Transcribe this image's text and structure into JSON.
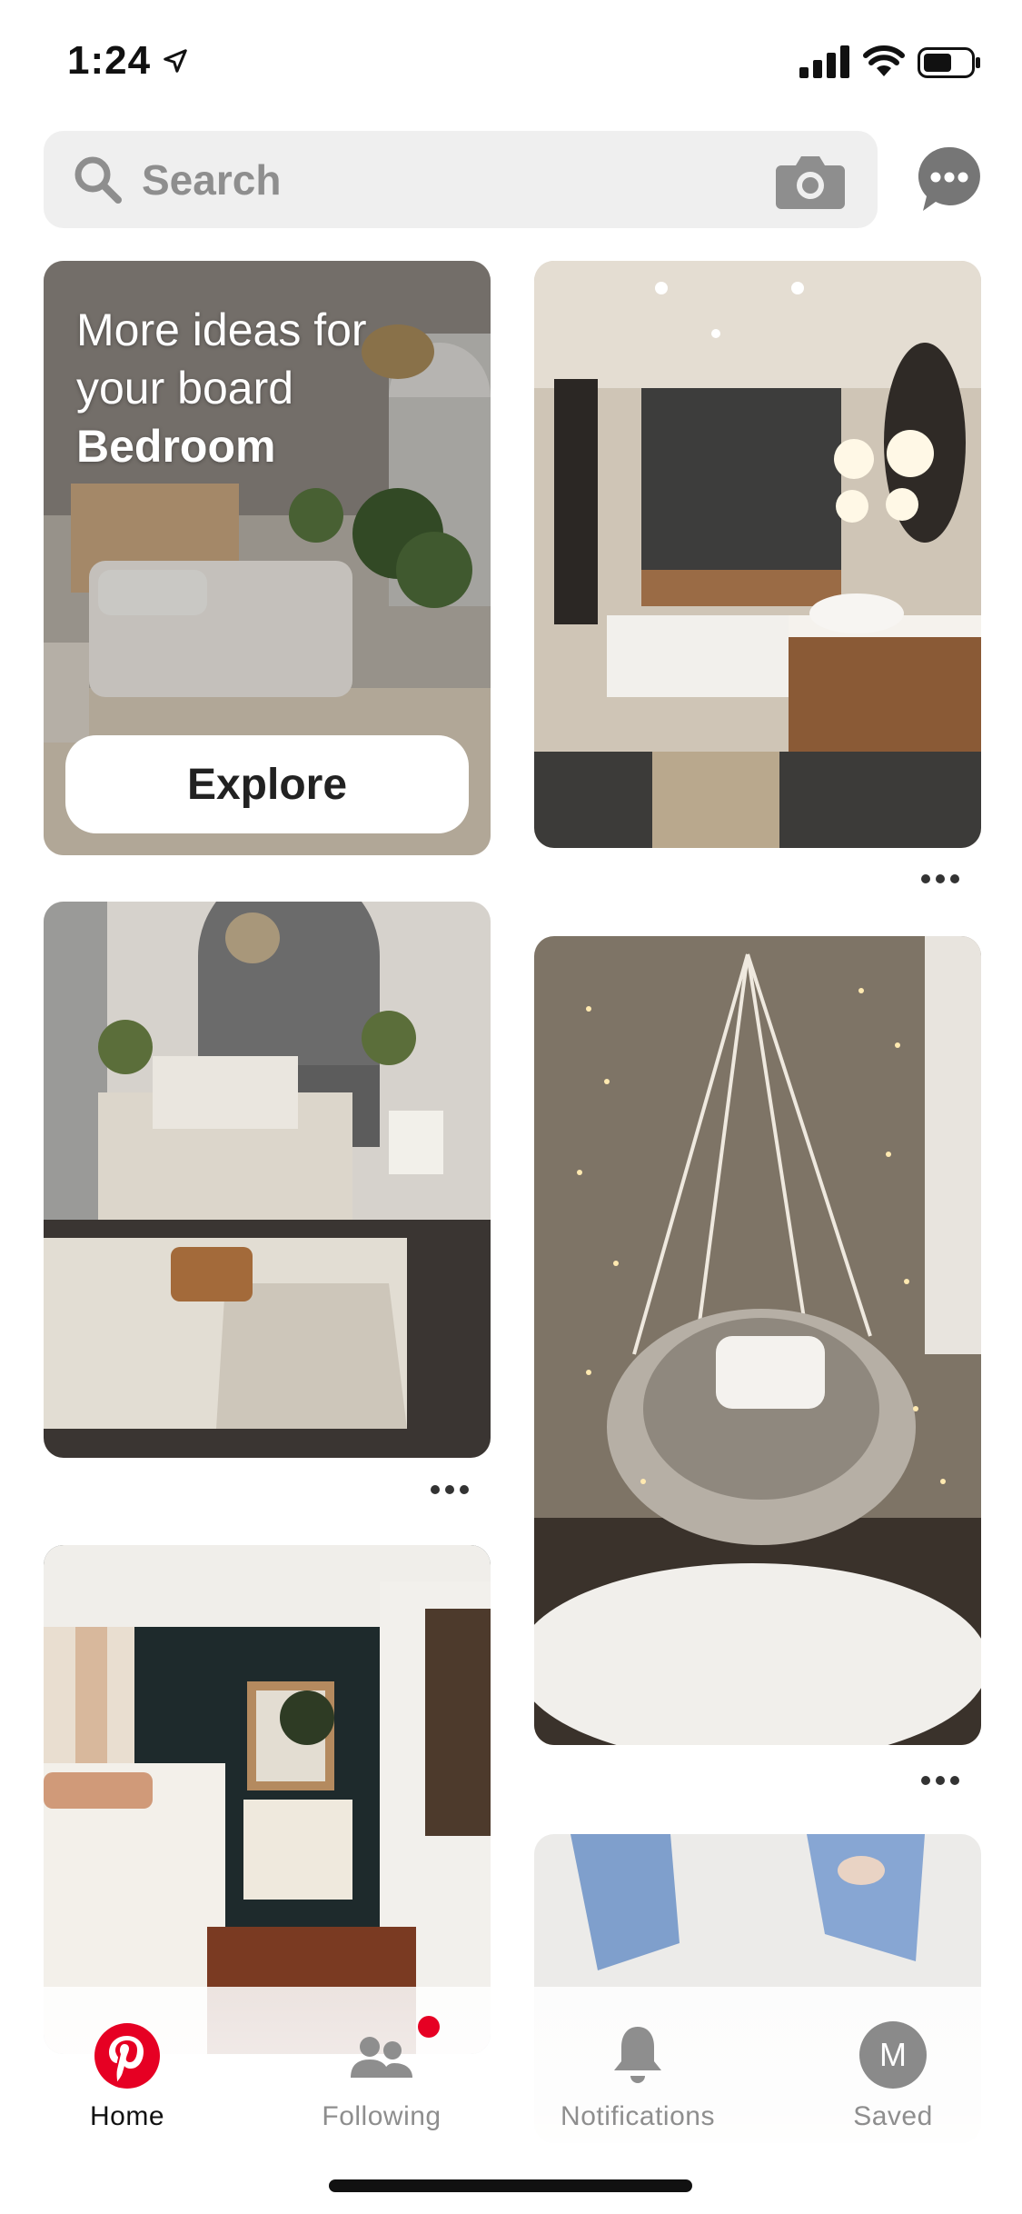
{
  "status_bar": {
    "time": "1:24"
  },
  "search": {
    "placeholder": "Search"
  },
  "board_card": {
    "line1": "More ideas for",
    "line2": "your board",
    "board_name": "Bedroom",
    "button_label": "Explore"
  },
  "tabs": [
    {
      "label": "Home",
      "active": true
    },
    {
      "label": "Following",
      "has_notification": true
    },
    {
      "label": "Notifications"
    },
    {
      "label": "Saved",
      "avatar_letter": "M"
    }
  ],
  "colors": {
    "brand": "#e60023",
    "search_bg": "#efefef",
    "inactive_text": "#8e8e8e"
  },
  "icons": [
    "location-arrow-icon",
    "signal-icon",
    "wifi-icon",
    "battery-icon",
    "search-icon",
    "camera-icon",
    "chat-icon",
    "more-icon",
    "pinterest-logo-icon",
    "following-icon",
    "bell-icon"
  ]
}
